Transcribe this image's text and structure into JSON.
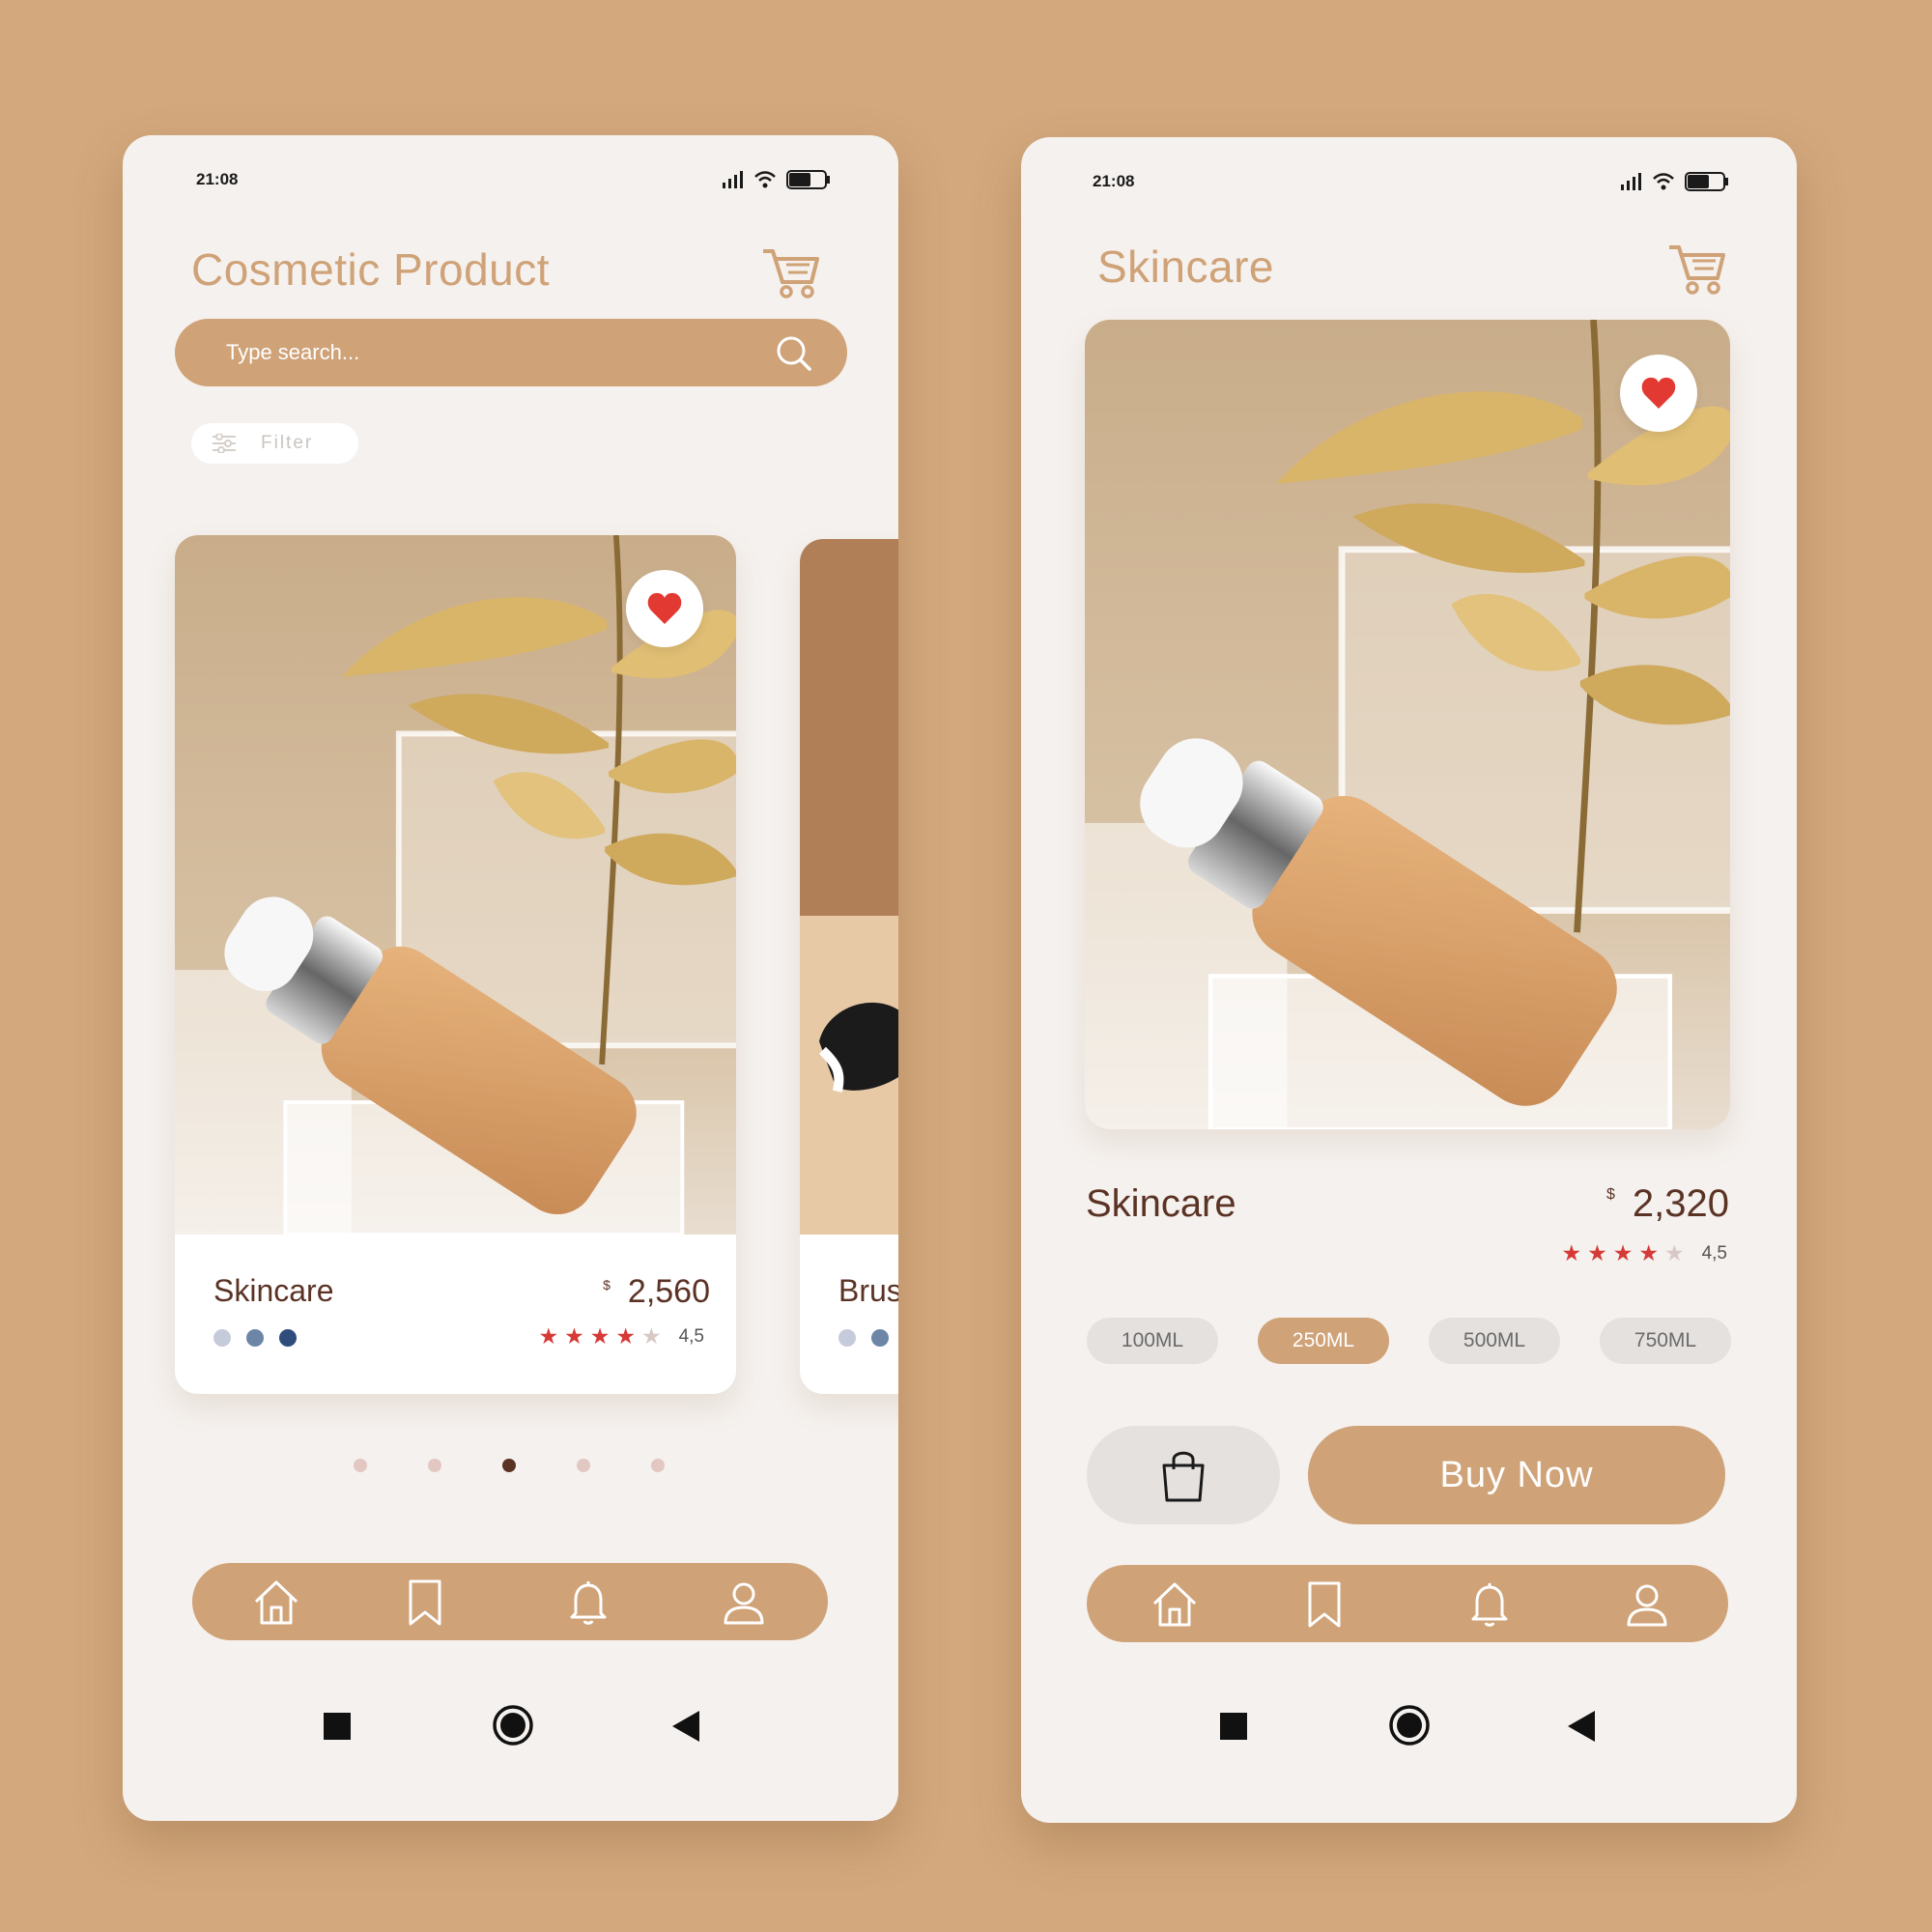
{
  "colors": {
    "background": "#d3a87d",
    "screen": "#f5f1ee",
    "accent": "#cfa277",
    "text_dark": "#5b3325",
    "star": "#d63a36",
    "heart": "#e23a32"
  },
  "left_screen": {
    "status_time": "21:08",
    "title": "Cosmetic Product",
    "search": {
      "placeholder": "Type search..."
    },
    "filter_label": "Filter",
    "cards": [
      {
        "name": "Skincare",
        "currency": "$",
        "price": "2,560",
        "rating": "4,5",
        "stars_filled": 4,
        "favorite": true,
        "swatches": [
          "#c5cbdb",
          "#6d86a8",
          "#2f4c7d"
        ]
      },
      {
        "name": "Brus",
        "swatches": [
          "#c5cbdb",
          "#6d86a8"
        ]
      }
    ],
    "pagination": {
      "count": 5,
      "active_index": 2
    },
    "nav": [
      "home-icon",
      "bookmark-icon",
      "bell-icon",
      "user-icon"
    ]
  },
  "right_screen": {
    "status_time": "21:08",
    "title": "Skincare",
    "product": {
      "name": "Skincare",
      "currency": "$",
      "price": "2,320",
      "rating": "4,5",
      "stars_filled": 4,
      "favorite": true
    },
    "sizes": [
      "100ML",
      "250ML",
      "500ML",
      "750ML"
    ],
    "selected_size": "250ML",
    "buy_label": "Buy Now",
    "nav": [
      "home-icon",
      "bookmark-icon",
      "bell-icon",
      "user-icon"
    ]
  }
}
